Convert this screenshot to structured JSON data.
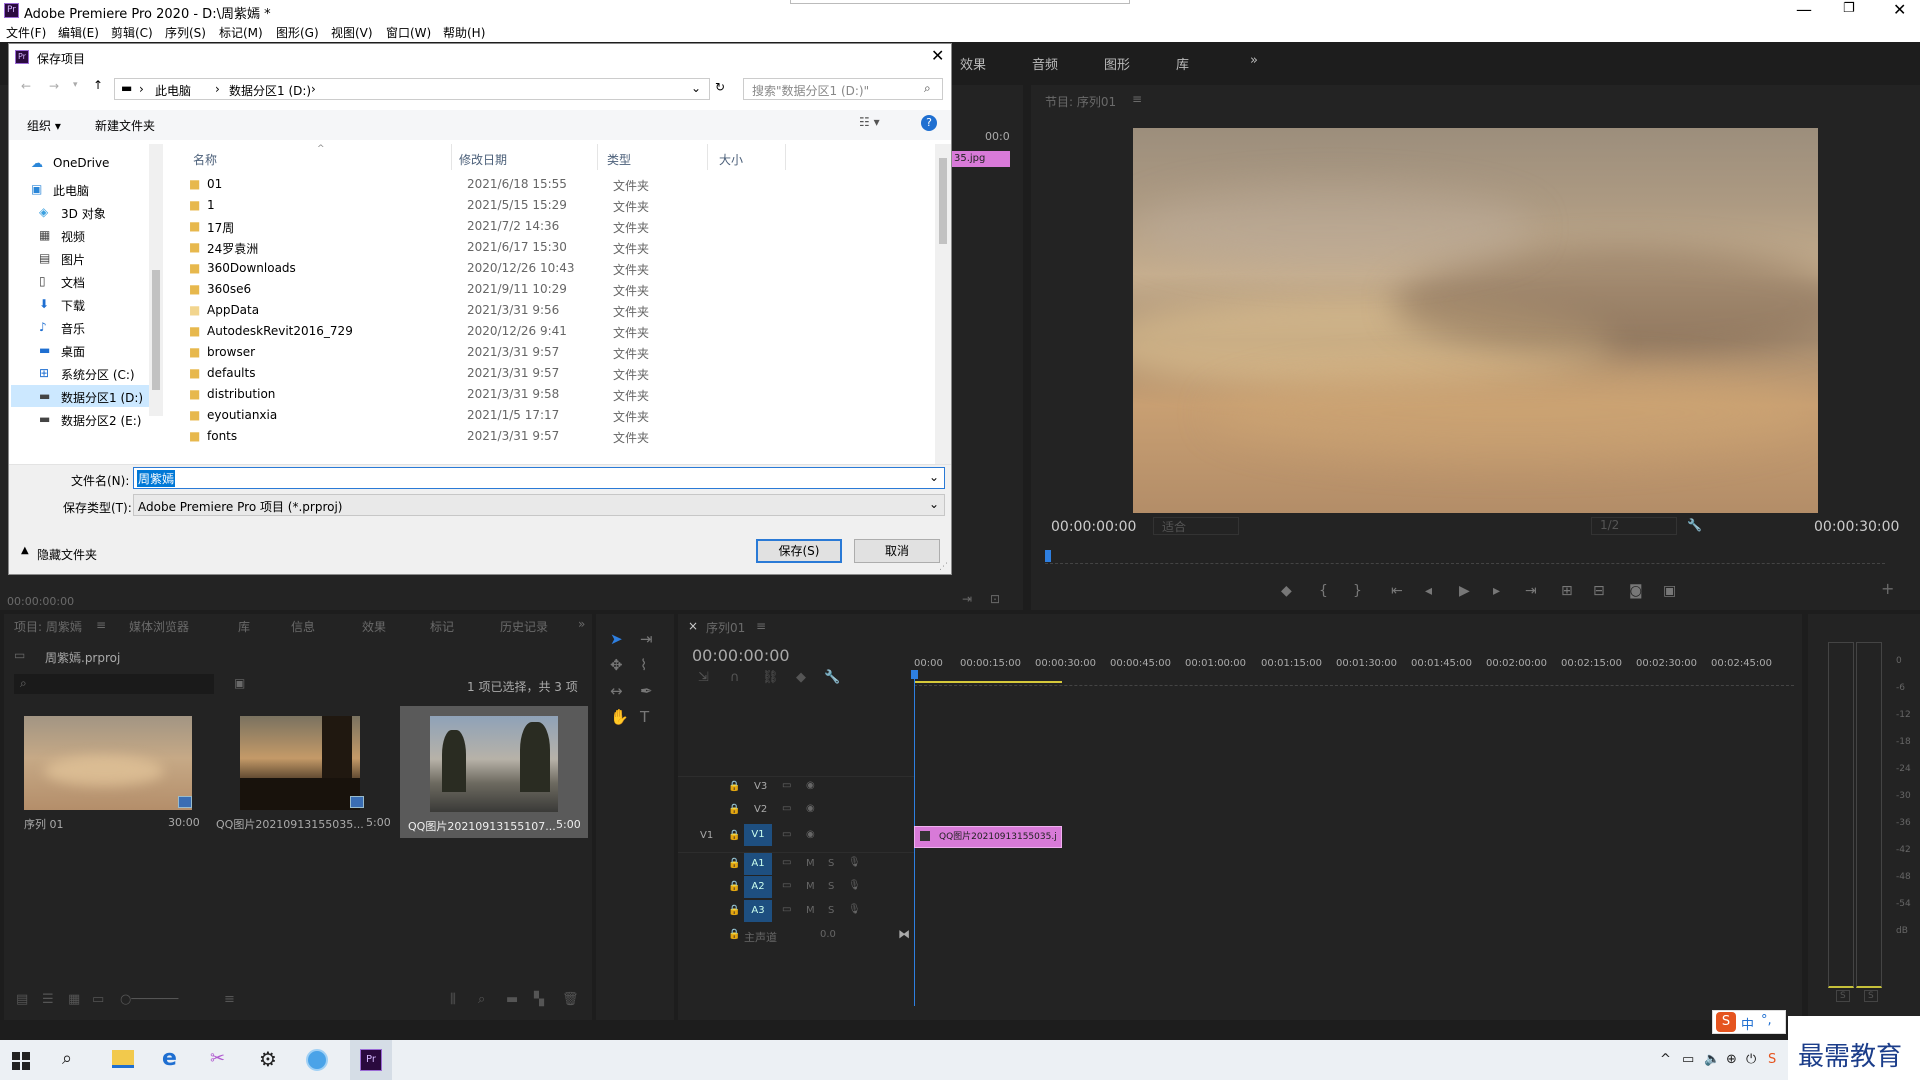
{
  "app": {
    "title": "Adobe Premiere Pro 2020 - D:\\周紫嫣 *"
  },
  "menu": [
    "文件(F)",
    "编辑(E)",
    "剪辑(C)",
    "序列(S)",
    "标记(M)",
    "图形(G)",
    "视图(V)",
    "窗口(W)",
    "帮助(H)"
  ],
  "workspace_tabs": [
    "效果",
    "音频",
    "图形",
    "库"
  ],
  "program": {
    "title": "节目: 序列01",
    "tc_left": "00:00:00:00",
    "fit": "适合",
    "res": "1/2",
    "tc_right": "00:00:30:00"
  },
  "source_top": {
    "clip": "35.jpg",
    "tc": "00:0"
  },
  "source": {
    "tc": "00:00:00:00"
  },
  "project": {
    "tabs": [
      "项目: 周紫嫣",
      "媒体浏览器",
      "库",
      "信息",
      "效果",
      "标记",
      "历史记录"
    ],
    "file": "周紫嫣.prproj",
    "selection": "1 项已选择，共 3 项",
    "items": [
      {
        "name": "序列 01",
        "duration": "30:00"
      },
      {
        "name": "QQ图片20210913155035...",
        "duration": "5:00"
      },
      {
        "name": "QQ图片20210913155107...",
        "duration": "5:00"
      }
    ]
  },
  "timeline": {
    "tab": "序列01",
    "tc": "00:00:00:00",
    "ruler": [
      "00:00",
      "00:00:15:00",
      "00:00:30:00",
      "00:00:45:00",
      "00:01:00:00",
      "00:01:15:00",
      "00:01:30:00",
      "00:01:45:00",
      "00:02:00:00",
      "00:02:15:00",
      "00:02:30:00",
      "00:02:45:00"
    ],
    "video_tracks": [
      "V3",
      "V2",
      "V1"
    ],
    "audio_tracks": [
      "A1",
      "A2",
      "A3"
    ],
    "src_v": "V1",
    "master": "主声道",
    "master_val": "0.0",
    "clip": "QQ图片20210913155035.j"
  },
  "meter": {
    "ticks": [
      "0",
      "-6",
      "-12",
      "-18",
      "-24",
      "-30",
      "-36",
      "-42",
      "-48",
      "-54",
      "dB"
    ],
    "solo": "S"
  },
  "dialog": {
    "title": "保存项目",
    "path": [
      "此电脑",
      "数据分区1 (D:)"
    ],
    "search_placeholder": "搜索\"数据分区1 (D:)\"",
    "organize": "组织 ▾",
    "new_folder": "新建文件夹",
    "columns": {
      "name": "名称",
      "date": "修改日期",
      "type": "类型",
      "size": "大小"
    },
    "nav": [
      "OneDrive",
      "此电脑",
      "3D 对象",
      "视频",
      "图片",
      "文档",
      "下载",
      "音乐",
      "桌面",
      "系统分区 (C:)",
      "数据分区1 (D:)",
      "数据分区2 (E:)"
    ],
    "files": [
      {
        "name": "01",
        "date": "2021/6/18 15:55",
        "type": "文件夹"
      },
      {
        "name": "1",
        "date": "2021/5/15 15:29",
        "type": "文件夹"
      },
      {
        "name": "17周",
        "date": "2021/7/2 14:36",
        "type": "文件夹"
      },
      {
        "name": "24罗袁洲",
        "date": "2021/6/17 15:30",
        "type": "文件夹"
      },
      {
        "name": "360Downloads",
        "date": "2020/12/26 10:43",
        "type": "文件夹"
      },
      {
        "name": "360se6",
        "date": "2021/9/11 10:29",
        "type": "文件夹"
      },
      {
        "name": "AppData",
        "date": "2021/3/31 9:56",
        "type": "文件夹"
      },
      {
        "name": "AutodeskRevit2016_729",
        "date": "2020/12/26 9:41",
        "type": "文件夹"
      },
      {
        "name": "browser",
        "date": "2021/3/31 9:57",
        "type": "文件夹"
      },
      {
        "name": "defaults",
        "date": "2021/3/31 9:57",
        "type": "文件夹"
      },
      {
        "name": "distribution",
        "date": "2021/3/31 9:58",
        "type": "文件夹"
      },
      {
        "name": "eyoutianxia",
        "date": "2021/1/5 17:17",
        "type": "文件夹"
      },
      {
        "name": "fonts",
        "date": "2021/3/31 9:57",
        "type": "文件夹"
      }
    ],
    "filename_label": "文件名(N):",
    "filename_value": "周紫嫣",
    "filetype_label": "保存类型(T):",
    "filetype_value": "Adobe Premiere Pro 项目 (*.prproj)",
    "hide_folders": "隐藏文件夹",
    "save": "保存(S)",
    "cancel": "取消"
  },
  "tray": {
    "ime": "中",
    "watermark": "最需教育"
  }
}
